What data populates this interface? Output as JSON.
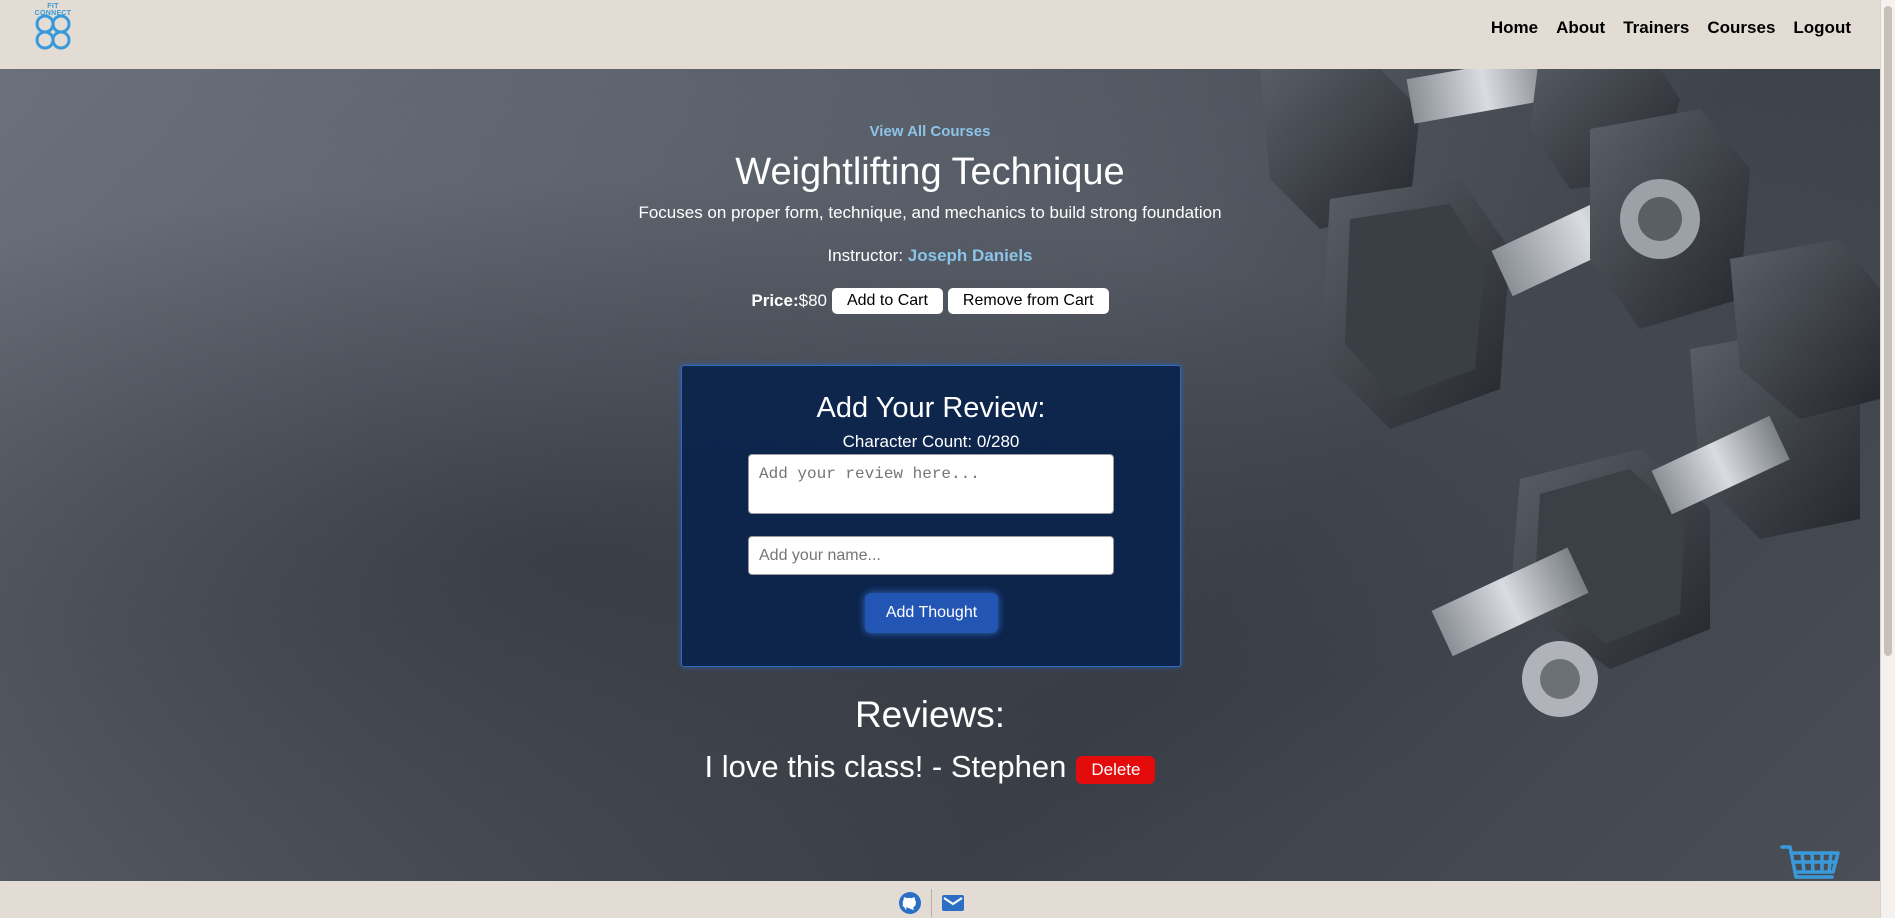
{
  "header": {
    "logo_text": "FIT CONNECT",
    "nav": [
      "Home",
      "About",
      "Trainers",
      "Courses",
      "Logout"
    ]
  },
  "course": {
    "view_all": "View All Courses",
    "title": "Weightlifting Technique",
    "description": "Focuses on proper form, technique, and mechanics to build strong foundation",
    "instructor_label": "Instructor: ",
    "instructor_name": "Joseph Daniels",
    "price_label": "Price:",
    "price_value": "$80",
    "add_to_cart": "Add to Cart",
    "remove_from_cart": "Remove from Cart"
  },
  "review_form": {
    "title": "Add Your Review:",
    "char_count": "Character Count: 0/280",
    "review_placeholder": "Add your review here...",
    "name_placeholder": "Add your name...",
    "submit": "Add Thought"
  },
  "reviews": {
    "title": "Reviews:",
    "items": [
      {
        "text": "I love this class! - Stephen",
        "delete_label": "Delete"
      }
    ]
  },
  "footer": {
    "icons": [
      "github-icon",
      "mail-icon"
    ]
  },
  "colors": {
    "accent_link": "#8cc4e8",
    "review_box": "#0a224b",
    "submit_button": "#2355b5",
    "delete_button": "#e30b0b",
    "cart_icon": "#3a9ad9",
    "header_bg": "#e3dcd5"
  }
}
